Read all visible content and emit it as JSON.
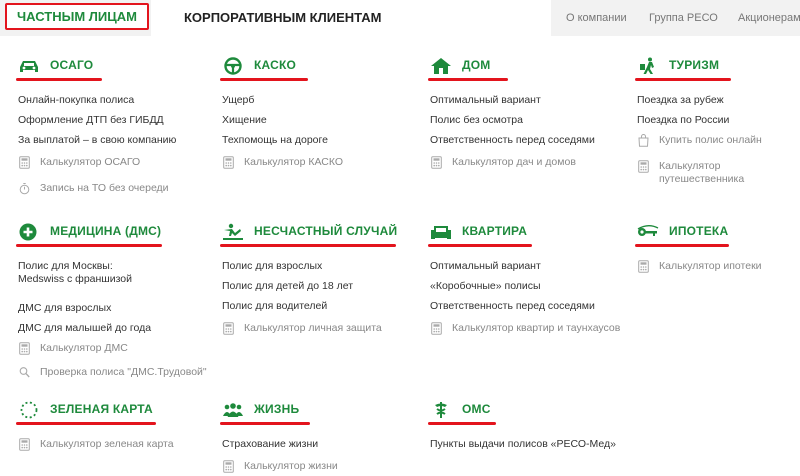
{
  "topnav": {
    "private": "ЧАСТНЫМ ЛИЦАМ",
    "corporate": "КОРПОРАТИВНЫМ КЛИЕНТАМ",
    "links": [
      "О компании",
      "Группа РЕСО",
      "Акционерам"
    ]
  },
  "colors": {
    "brand_green": "#1e8a3c",
    "accent_red": "#e3141d"
  },
  "categories": [
    {
      "title": "ОСАГО",
      "icon": "car-icon",
      "items": [
        {
          "text": "Онлайн-покупка полиса"
        },
        {
          "text": "Оформление ДТП без ГИБДД"
        },
        {
          "text": "За выплатой – в свою компанию"
        },
        {
          "text": "Калькулятор ОСАГО",
          "icon": "calculator-icon"
        },
        {
          "text": "Запись на ТО без очереди",
          "icon": "stopwatch-icon"
        }
      ]
    },
    {
      "title": "КАСКО",
      "icon": "steering-wheel-icon",
      "items": [
        {
          "text": "Ущерб"
        },
        {
          "text": "Хищение"
        },
        {
          "text": "Техпомощь на дороге"
        },
        {
          "text": "Калькулятор КАСКО",
          "icon": "calculator-icon"
        }
      ]
    },
    {
      "title": "ДОМ",
      "icon": "house-icon",
      "items": [
        {
          "text": "Оптимальный вариант"
        },
        {
          "text": "Полис без осмотра"
        },
        {
          "text": "Ответственность перед соседями"
        },
        {
          "text": "Калькулятор дач и домов",
          "icon": "calculator-icon"
        }
      ]
    },
    {
      "title": "ТУРИЗМ",
      "icon": "traveler-icon",
      "items": [
        {
          "text": "Поездка за рубеж"
        },
        {
          "text": "Поездка по России"
        },
        {
          "text": "Купить полис онлайн",
          "icon": "shopping-bag-icon"
        },
        {
          "text": "Калькулятор\nпутешественника",
          "icon": "calculator-icon"
        }
      ]
    },
    {
      "title": "МЕДИЦИНА (ДМС)",
      "icon": "medical-cross-icon",
      "items": [
        {
          "text": "Полис для Москвы:\nMedswiss с франшизой"
        },
        {
          "text": "ДМС для взрослых"
        },
        {
          "text": "ДМС для малышей до года"
        },
        {
          "text": "Калькулятор ДМС",
          "icon": "calculator-icon"
        },
        {
          "text": "Проверка полиса \"ДМС.Трудовой\"",
          "icon": "magnifier-icon"
        }
      ]
    },
    {
      "title": "НЕСЧАСТНЫЙ СЛУЧАЙ",
      "icon": "falling-person-icon",
      "items": [
        {
          "text": "Полис для взрослых"
        },
        {
          "text": "Полис для детей до 18 лет"
        },
        {
          "text": "Полис для водителей"
        },
        {
          "text": "Калькулятор личная защита",
          "icon": "calculator-icon"
        }
      ]
    },
    {
      "title": "КВАРТИРА",
      "icon": "sofa-icon",
      "items": [
        {
          "text": "Оптимальный вариант"
        },
        {
          "text": "«Коробочные» полисы"
        },
        {
          "text": "Ответственность перед соседями"
        },
        {
          "text": "Калькулятор квартир и таунхаусов",
          "icon": "calculator-icon"
        }
      ]
    },
    {
      "title": "ИПОТЕКА",
      "icon": "key-icon",
      "items": [
        {
          "text": "Калькулятор ипотеки",
          "icon": "calculator-icon"
        }
      ]
    },
    {
      "title": "ЗЕЛЕНАЯ КАРТА",
      "icon": "dotted-circle-icon",
      "items": [
        {
          "text": "Калькулятор зеленая карта",
          "icon": "calculator-icon"
        }
      ]
    },
    {
      "title": "ЖИЗНЬ",
      "icon": "people-group-icon",
      "items": [
        {
          "text": "Страхование жизни"
        },
        {
          "text": "Калькулятор жизни",
          "icon": "calculator-icon"
        }
      ]
    },
    {
      "title": "ОМС",
      "icon": "caduceus-icon",
      "items": [
        {
          "text": "Пункты выдачи полисов «РЕСО-Мед»"
        }
      ]
    }
  ]
}
